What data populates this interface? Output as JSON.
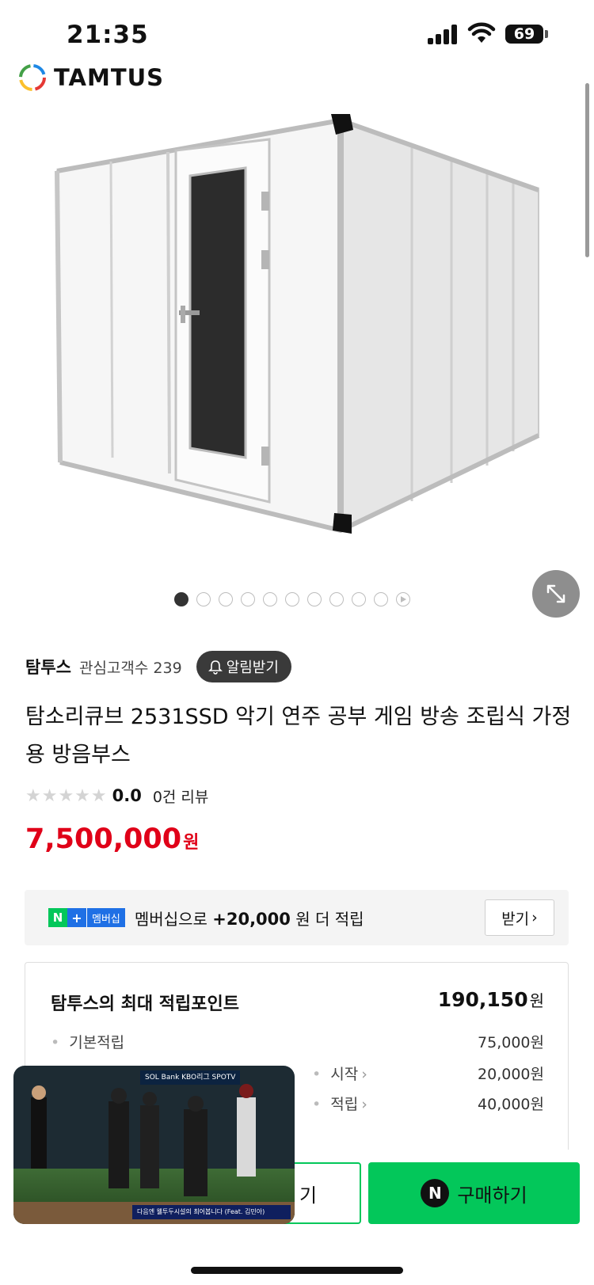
{
  "status_bar": {
    "time": "21:35",
    "battery": "69"
  },
  "brand": {
    "name": "TAMTUS"
  },
  "gallery": {
    "total_images": 11,
    "active_index": 0
  },
  "store": {
    "name": "탐투스",
    "fans": "관심고객수 239",
    "alarm_label": "알림받기"
  },
  "product": {
    "title": "탐소리큐브 2531SSD 악기 연주 공부 게임 방송 조립식 가정용 방음부스",
    "rating": {
      "score": "0.0",
      "review_text": "0건 리뷰",
      "stars": "★★★★★"
    },
    "price": {
      "value": "7,500,000",
      "unit": "원"
    }
  },
  "membership": {
    "badge_n": "N",
    "badge_plus": "+",
    "badge_label": "멤버십",
    "text_prefix": "멤버십으로",
    "amount": "+20,000",
    "text_suffix": "원 더 적립",
    "button": "받기"
  },
  "points": {
    "title": "탐투스의 최대 적립포인트",
    "total": "190,150",
    "total_unit": "원",
    "rows": [
      {
        "label": "기본적립",
        "value": "75,000원"
      },
      {
        "label": "시작",
        "value": "20,000원"
      },
      {
        "label": "적립",
        "value": "40,000원"
      }
    ]
  },
  "bottom": {
    "cart_label": "기",
    "buy_icon": "N",
    "buy_label": "구매하기"
  },
  "pip": {
    "scoreboard": "SOL Bank KBO리그 SPOTV",
    "ticker": "다음엔 웰투두시설의 최어봅니다 (Feat. 김민아)"
  }
}
